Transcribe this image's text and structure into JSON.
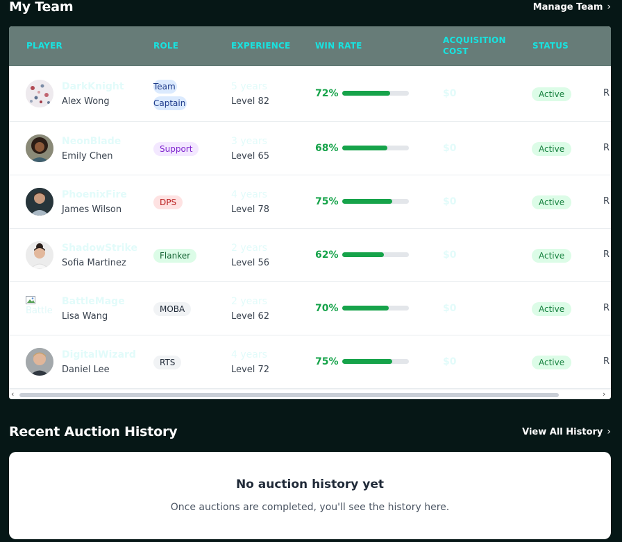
{
  "my_team": {
    "title": "My Team",
    "manage_label": "Manage Team",
    "columns": {
      "player": "PLAYER",
      "role": "ROLE",
      "experience": "EXPERIENCE",
      "win_rate": "WIN RATE",
      "acquisition_cost_line1": "ACQUISITION",
      "acquisition_cost_line2": "COST",
      "status": "STATUS"
    },
    "players": [
      {
        "handle": "DarkKnight",
        "name": "Alex Wong",
        "role": "Team Captain",
        "experience": "5 years",
        "level": "Level 82",
        "win_rate": "72%",
        "win_rate_value": 72,
        "cost": "$0",
        "status": "Active",
        "extra": "R"
      },
      {
        "handle": "NeonBlade",
        "name": "Emily Chen",
        "role": "Support",
        "experience": "3 years",
        "level": "Level 65",
        "win_rate": "68%",
        "win_rate_value": 68,
        "cost": "$0",
        "status": "Active",
        "extra": "R"
      },
      {
        "handle": "PhoenixFire",
        "name": "James Wilson",
        "role": "DPS",
        "experience": "4 years",
        "level": "Level 78",
        "win_rate": "75%",
        "win_rate_value": 75,
        "cost": "$0",
        "status": "Active",
        "extra": "R"
      },
      {
        "handle": "ShadowStrike",
        "name": "Sofia Martinez",
        "role": "Flanker",
        "experience": "2 years",
        "level": "Level 56",
        "win_rate": "62%",
        "win_rate_value": 62,
        "cost": "$0",
        "status": "Active",
        "extra": "R"
      },
      {
        "handle": "BattleMage",
        "name": "Lisa Wang",
        "role": "MOBA",
        "experience": "2 years",
        "level": "Level 62",
        "win_rate": "70%",
        "win_rate_value": 70,
        "cost": "$0",
        "status": "Active",
        "extra": "R",
        "avatar_alt": "Battle"
      },
      {
        "handle": "DigitalWizard",
        "name": "Daniel Lee",
        "role": "RTS",
        "experience": "4 years",
        "level": "Level 72",
        "win_rate": "75%",
        "win_rate_value": 75,
        "cost": "$0",
        "status": "Active",
        "extra": "R"
      }
    ]
  },
  "auction_history": {
    "title": "Recent Auction History",
    "view_all_label": "View All History",
    "empty_title": "No auction history yet",
    "empty_subtitle": "Once auctions are completed, you'll see the history here."
  },
  "colors": {
    "background": "#061716",
    "header_row": "#677c78",
    "header_text": "#18e3e0",
    "win_rate": "#16a34a",
    "status_bg": "#dcfce7"
  }
}
